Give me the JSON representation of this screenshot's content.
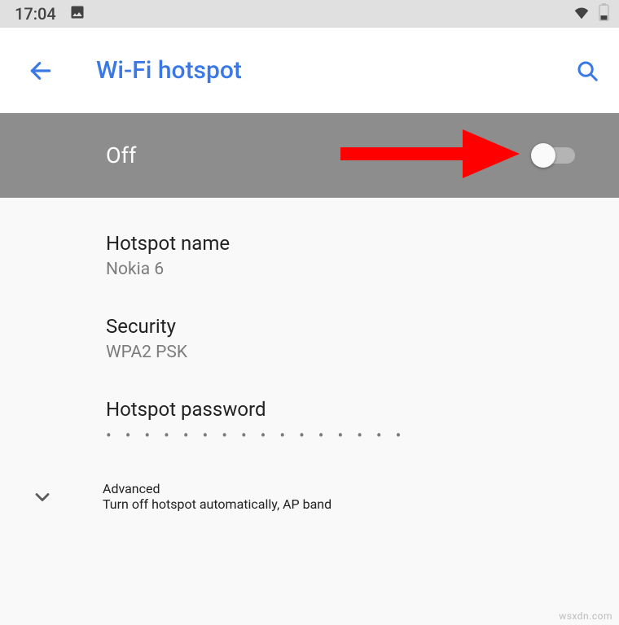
{
  "status": {
    "time": "17:04"
  },
  "header": {
    "title": "Wi-Fi hotspot"
  },
  "toggle": {
    "label": "Off",
    "state": "off"
  },
  "items": {
    "name": {
      "title": "Hotspot name",
      "value": "Nokia 6"
    },
    "security": {
      "title": "Security",
      "value": "WPA2 PSK"
    },
    "password": {
      "title": "Hotspot password",
      "value": "• • • • • • • • • • • • • • • •"
    },
    "advanced": {
      "title": "Advanced",
      "value": "Turn off hotspot automatically, AP band"
    }
  },
  "watermark": "wsxdn.com",
  "annotation": {
    "arrow_color": "#ff0000"
  }
}
